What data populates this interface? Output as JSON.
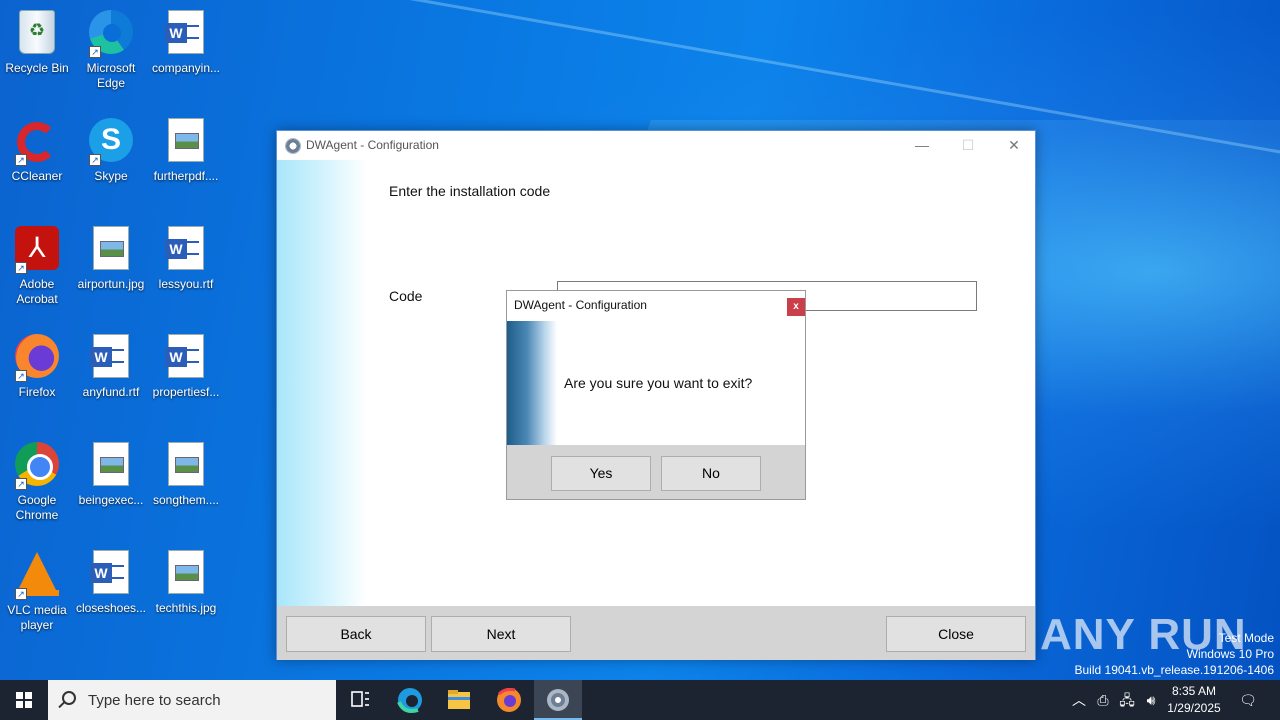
{
  "desktop": {
    "icons": [
      {
        "label": "Recycle Bin",
        "icon": "recycle-bin-icon"
      },
      {
        "label": "Microsoft Edge",
        "icon": "edge-icon"
      },
      {
        "label": "companyin...",
        "icon": "word-document-icon"
      },
      {
        "label": "CCleaner",
        "icon": "ccleaner-icon"
      },
      {
        "label": "Skype",
        "icon": "skype-icon"
      },
      {
        "label": "furtherpdf....",
        "icon": "image-file-icon"
      },
      {
        "label": "Adobe Acrobat",
        "icon": "acrobat-icon"
      },
      {
        "label": "airportun.jpg",
        "icon": "image-file-icon"
      },
      {
        "label": "lessyou.rtf",
        "icon": "word-document-icon"
      },
      {
        "label": "Firefox",
        "icon": "firefox-icon"
      },
      {
        "label": "anyfund.rtf",
        "icon": "word-document-icon"
      },
      {
        "label": "propertiesf...",
        "icon": "word-document-icon"
      },
      {
        "label": "Google Chrome",
        "icon": "chrome-icon"
      },
      {
        "label": "beingexec...",
        "icon": "image-file-icon"
      },
      {
        "label": "songthem....",
        "icon": "image-file-icon"
      },
      {
        "label": "VLC media player",
        "icon": "vlc-icon"
      },
      {
        "label": "closeshoes...",
        "icon": "word-document-icon"
      },
      {
        "label": "techthis.jpg",
        "icon": "image-file-icon"
      }
    ]
  },
  "main_window": {
    "title": "DWAgent - Configuration",
    "heading": "Enter the installation code",
    "code_label": "Code",
    "code_value": "",
    "back_label": "Back",
    "next_label": "Next",
    "close_label": "Close"
  },
  "confirm_dialog": {
    "title": "DWAgent - Configuration",
    "close_glyph": "x",
    "message": "Are you sure you want to exit?",
    "yes_label": "Yes",
    "no_label": "No"
  },
  "watermark": {
    "brand": "ANY RUN",
    "line1": "Test Mode",
    "line2": "Windows 10 Pro",
    "line3": "Build 19041.vb_release.191206-1406"
  },
  "taskbar": {
    "search_placeholder": "Type here to search",
    "time": "8:35 AM",
    "date": "1/29/2025",
    "pinned": [
      "task-view-icon",
      "edge-icon",
      "file-explorer-icon",
      "firefox-icon",
      "dwagent-icon"
    ]
  }
}
